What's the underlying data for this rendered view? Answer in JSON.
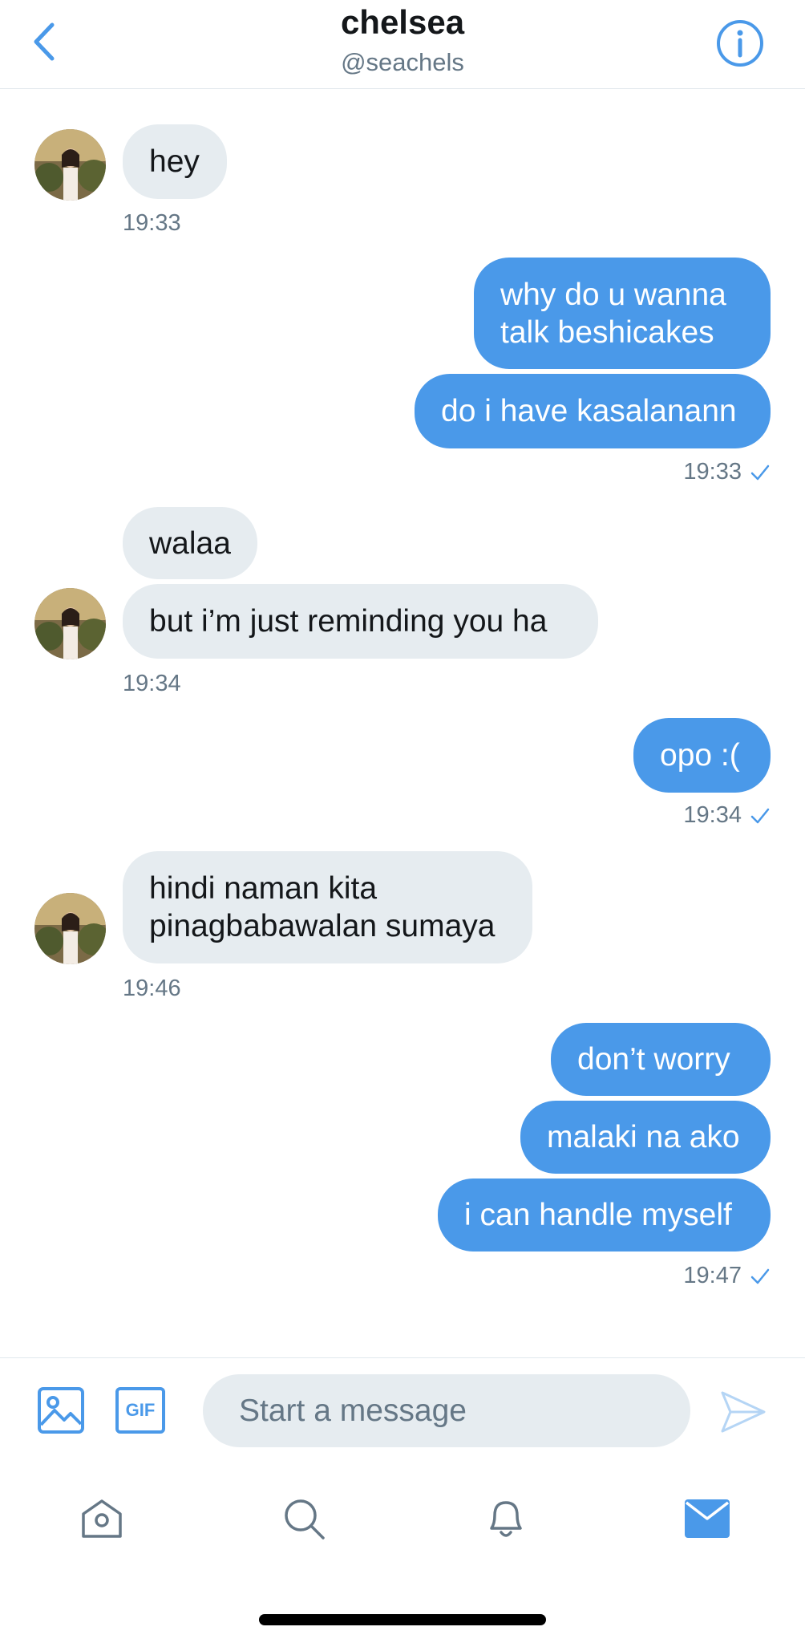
{
  "header": {
    "title": "chelsea",
    "handle": "@seachels"
  },
  "messages": [
    {
      "text": "hey"
    },
    {
      "time": "19:33"
    },
    {
      "text": "why do u wanna\ntalk beshicakes"
    },
    {
      "text": "do i have kasalanann"
    },
    {
      "time": "19:33"
    },
    {
      "text": "walaa"
    },
    {
      "text": "but i’m just reminding you ha"
    },
    {
      "time": "19:34"
    },
    {
      "text": "opo :("
    },
    {
      "time": "19:34"
    },
    {
      "text": "hindi naman kita\npinagbabawalan sumaya"
    },
    {
      "time": "19:46"
    },
    {
      "text": "don’t worry"
    },
    {
      "text": "malaki na ako"
    },
    {
      "text": "i can handle myself"
    },
    {
      "time": "19:47"
    }
  ],
  "composer": {
    "placeholder": "Start a message",
    "gif_label": "GIF"
  },
  "icons": {
    "back": "chevron-left-icon",
    "info": "info-icon",
    "image": "image-icon",
    "gif": "gif-icon",
    "send": "send-icon",
    "home": "home-icon",
    "search": "search-icon",
    "notifications": "bell-icon",
    "messages": "mail-icon"
  },
  "colors": {
    "accent": "#4a99e9",
    "incoming_bubble": "#e6ecf0",
    "meta_text": "#657786"
  }
}
